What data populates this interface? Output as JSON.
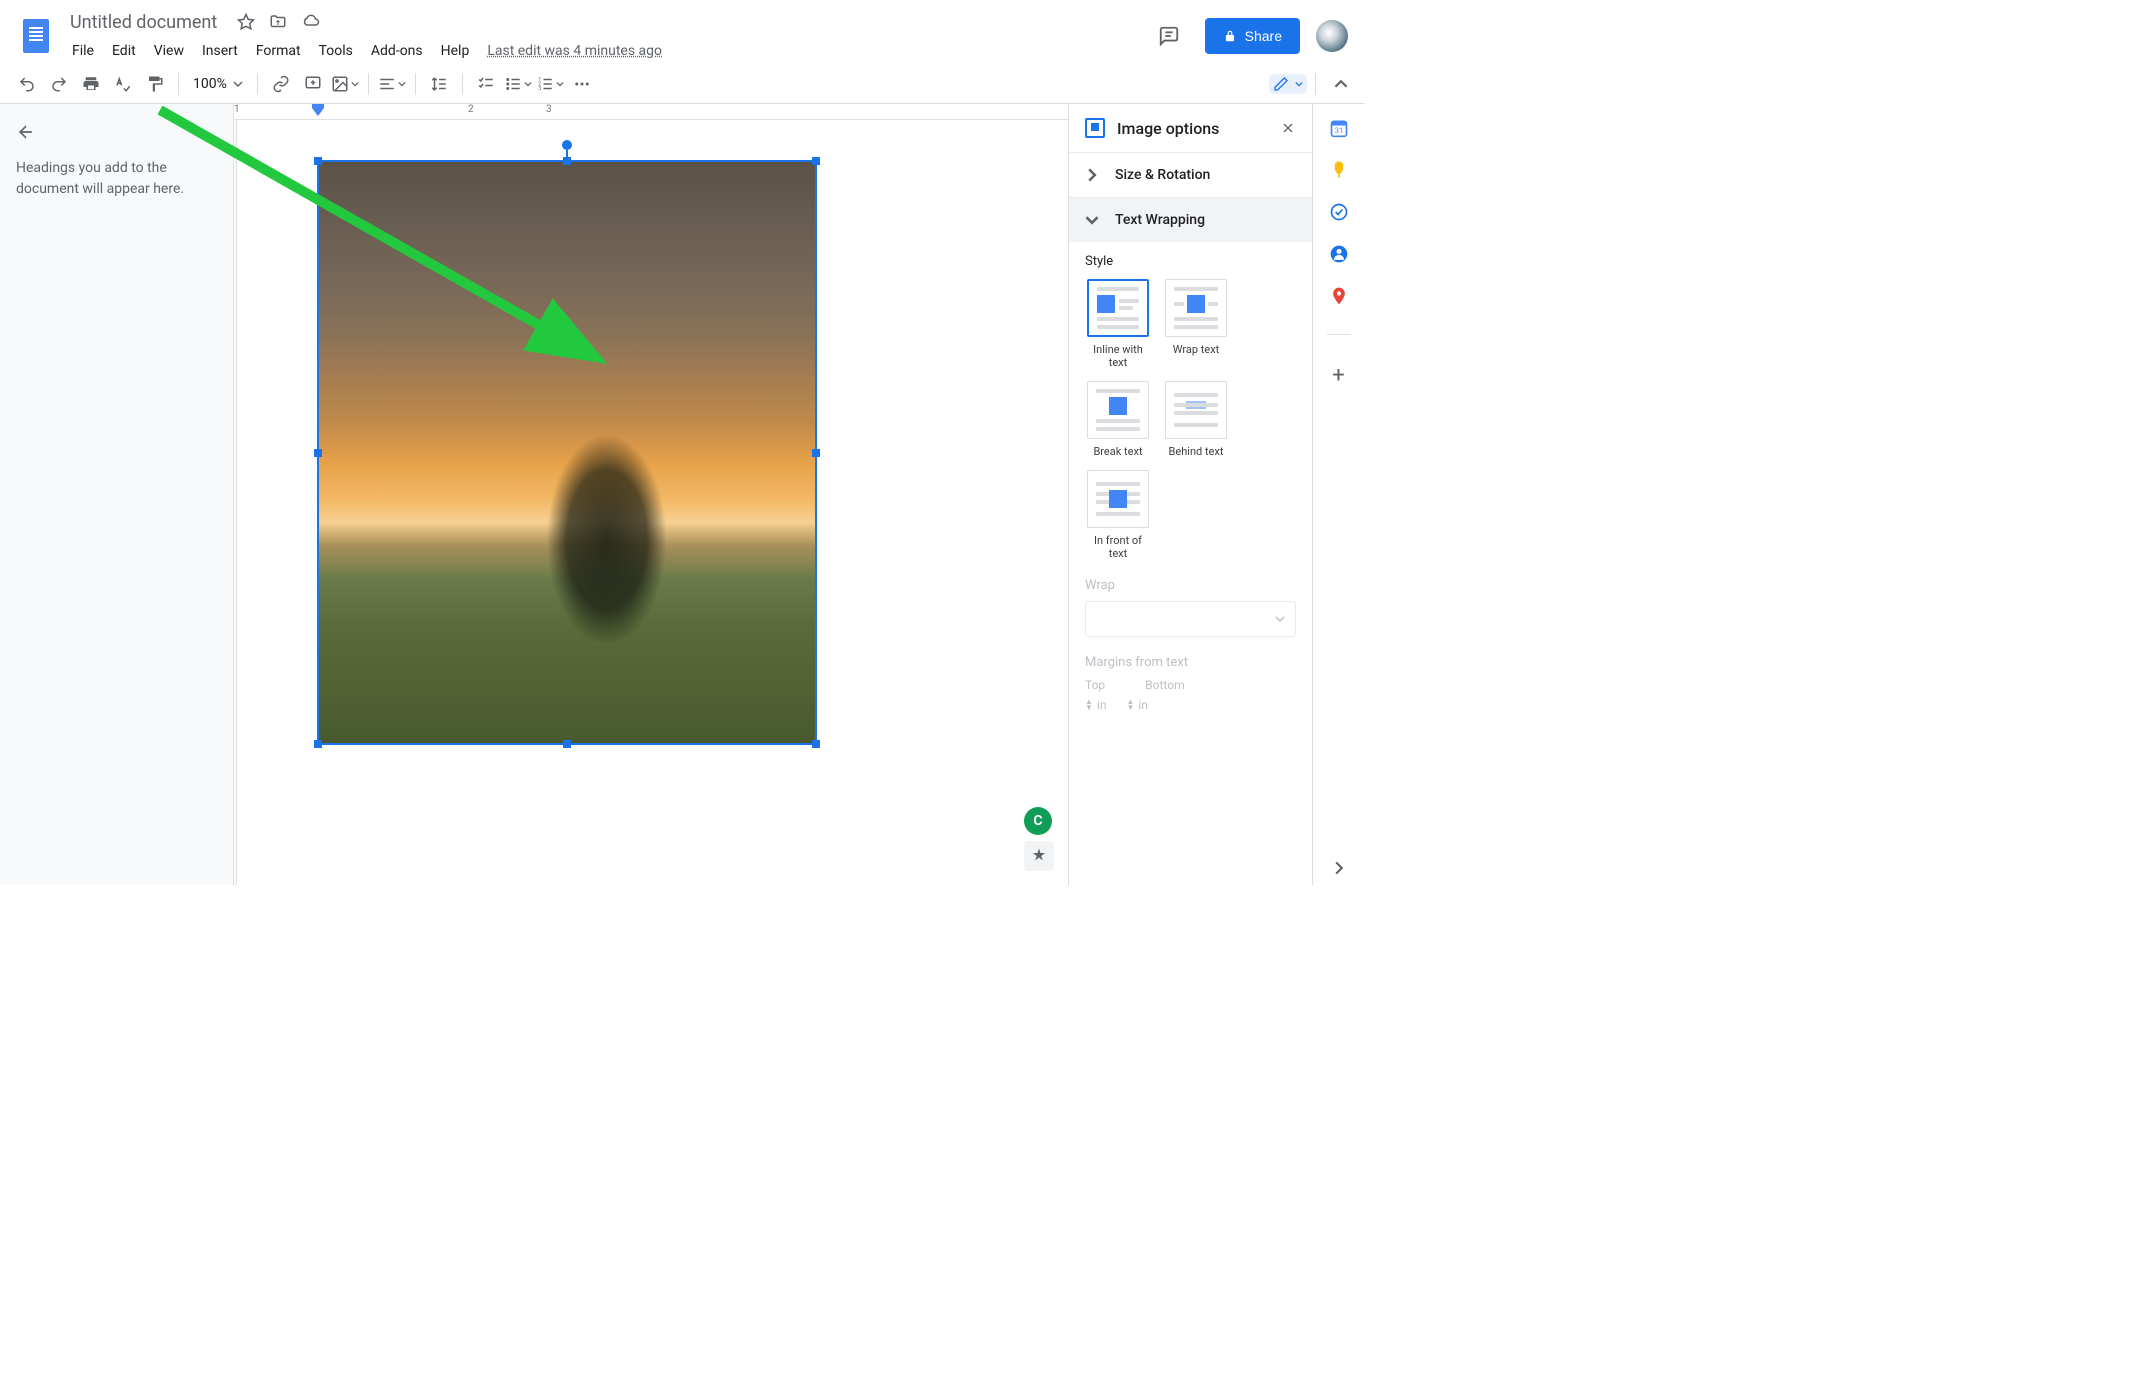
{
  "header": {
    "doc_title": "Untitled document",
    "menus": [
      "File",
      "Edit",
      "View",
      "Insert",
      "Format",
      "Tools",
      "Add-ons",
      "Help"
    ],
    "last_edit": "Last edit was 4 minutes ago",
    "share_label": "Share"
  },
  "toolbar": {
    "zoom": "100%"
  },
  "outline": {
    "placeholder": "Headings you add to the document will appear here."
  },
  "ruler": {
    "marks": [
      "1",
      "2",
      "3"
    ]
  },
  "panel": {
    "title": "Image options",
    "sections": {
      "size_rotation": "Size & Rotation",
      "text_wrapping": "Text Wrapping"
    },
    "style_label": "Style",
    "wrap_label": "Wrap",
    "margins_label": "Margins from text",
    "margin_top": "Top",
    "margin_bottom": "Bottom",
    "margin_unit": "in",
    "style_options": [
      {
        "id": "inline",
        "label": "Inline with text"
      },
      {
        "id": "wrap",
        "label": "Wrap text"
      },
      {
        "id": "break",
        "label": "Break text"
      },
      {
        "id": "behind",
        "label": "Behind text"
      },
      {
        "id": "front",
        "label": "In front of text"
      }
    ],
    "selected_style": "inline"
  },
  "rail": {
    "items": [
      "calendar",
      "keep",
      "tasks",
      "contacts",
      "maps"
    ]
  },
  "annotation": {
    "arrow_color": "#22c93e"
  }
}
